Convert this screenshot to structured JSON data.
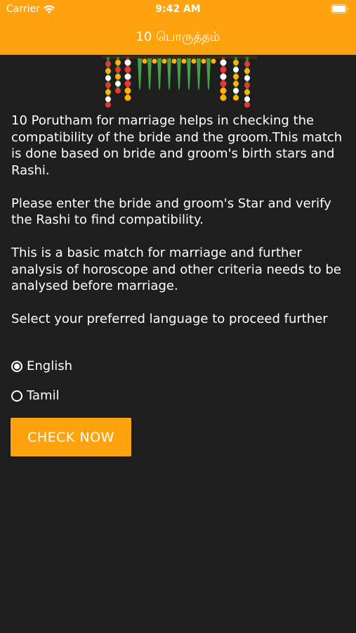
{
  "status_bar": {
    "carrier": "Carrier",
    "time": "9:42 AM"
  },
  "nav": {
    "title": "10 பொருத்தம்"
  },
  "content": {
    "paragraphs": [
      "10 Porutham for marriage helps in checking the compatibility of the bride and the groom.This match is done based on bride and groom's birth stars and Rashi.",
      "Please enter the bride and groom's Star and verify the Rashi to find compatibility.",
      "This is a basic match for marriage and further analysis of horoscope and other criteria needs to be analysed before marriage."
    ],
    "language_prompt": "Select your preferred language to proceed further"
  },
  "language_options": [
    {
      "label": "English",
      "selected": true
    },
    {
      "label": "Tamil",
      "selected": false
    }
  ],
  "button": {
    "label": "CHECK NOW"
  },
  "colors": {
    "accent": "#ffa20f",
    "background": "#1e1e1e",
    "text": "#ffffff"
  },
  "icons": {
    "wifi": "wifi-icon",
    "battery": "battery-icon",
    "decoration": "toran-garland-image"
  }
}
